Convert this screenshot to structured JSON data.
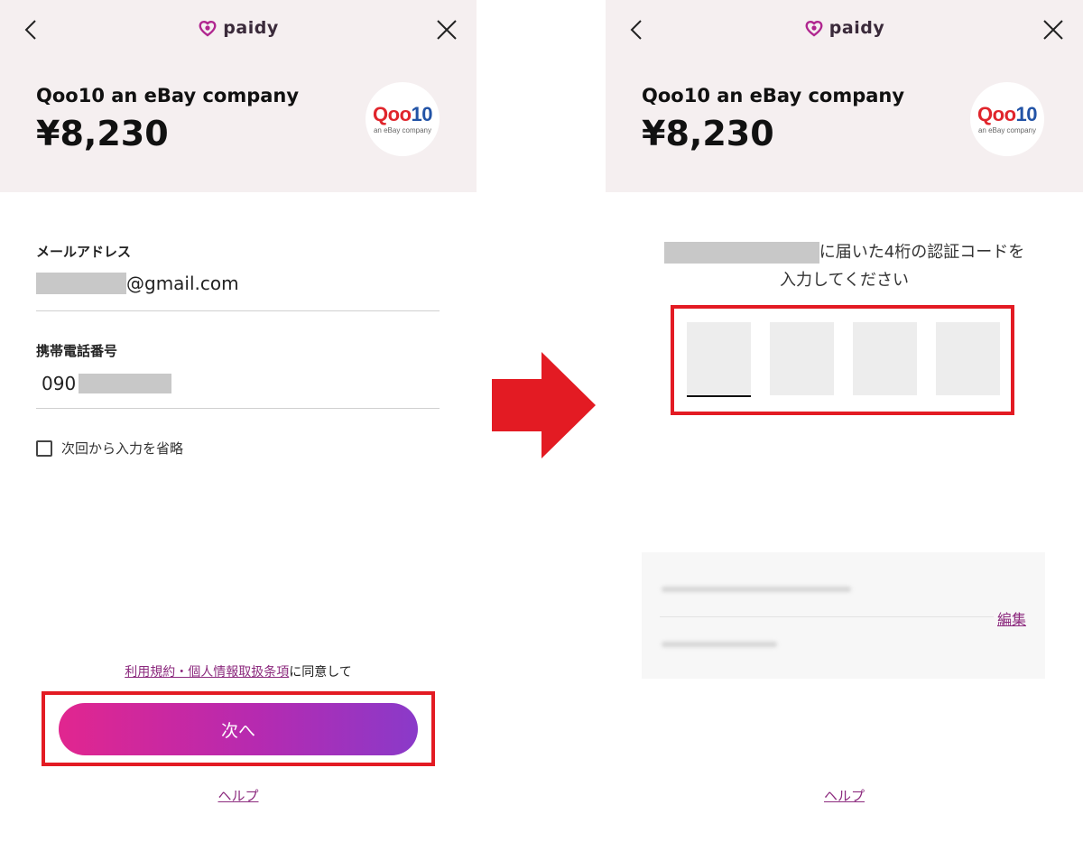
{
  "brand": {
    "name": "paidy",
    "logo_icon": "paidy-heart-logo",
    "color": "#b0258f"
  },
  "merchant": {
    "name": "Qoo10 an eBay company",
    "amount": "¥8,230",
    "logo_q": "Q",
    "logo_oo": "oo",
    "logo_10": "10",
    "logo_sub": "an eBay company"
  },
  "icons": {
    "back": "chevron-left-icon",
    "close": "close-icon"
  },
  "login_screen": {
    "email_label": "メールアドレス",
    "email_suffix": "@gmail.com",
    "phone_label": "携帯電話番号",
    "phone_prefix": "090",
    "remember_label": "次回から入力を省略",
    "remember_checked": false,
    "terms_link": "利用規約・個人情報取扱条項",
    "terms_suffix": "に同意して",
    "next_button": "次へ",
    "help": "ヘルプ"
  },
  "otp_screen": {
    "message_line1": "に届いた4桁の認証コードを",
    "message_line2": "入力してください",
    "code_digits": [
      "",
      "",
      "",
      ""
    ],
    "edit_link": "編集",
    "help": "ヘルプ"
  },
  "colors": {
    "accent": "#8c2a7e",
    "highlight": "#e31b23",
    "header_bg": "#f5eff0",
    "button_gradient": [
      "#e1268f",
      "#8a3ac9"
    ]
  }
}
